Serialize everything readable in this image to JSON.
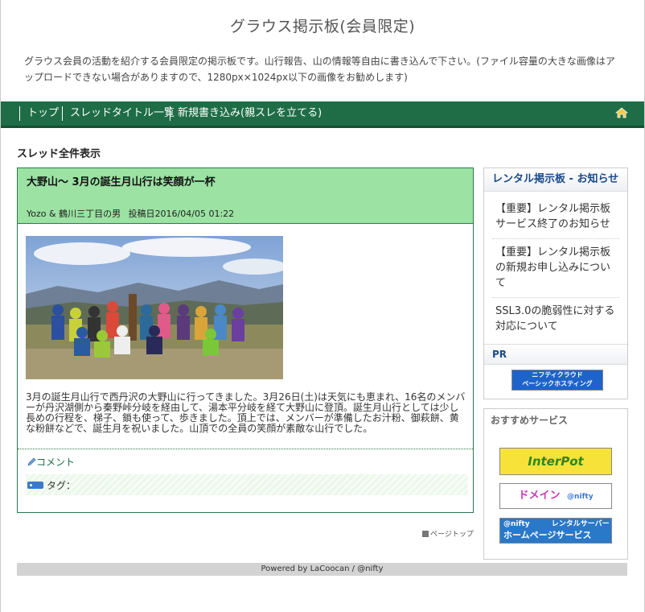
{
  "site": {
    "title": "グラウス掲示板(会員限定)",
    "description": "グラウス会員の活動を紹介する会員限定の掲示板です。山行報告、山の情報等自由に書き込んで下さい。(ファイル容量の大きな画像はアップロードできない場合がありますので、1280px×1024px以下の画像をお勧めします)"
  },
  "nav": {
    "items": [
      "トップ",
      "スレッドタイトル一覧",
      "新規書き込み(親スレを立てる)"
    ],
    "home_icon": "home-icon"
  },
  "section_title": "スレッド全件表示",
  "thread": {
    "title": "大野山～ 3月の誕生月山行は笑顔が一杯",
    "author": "Yozo & 鶴川三丁目の男",
    "posted_label": "投稿日",
    "posted_at": "2016/04/05 01:22",
    "body": "3月の誕生月山行で西丹沢の大野山に行ってきました。3月26日(土)は天気にも恵まれ、16名のメンバーが丹沢湖側から秦野峠分岐を経由して、湯本平分岐を経て大野山に登頂。誕生月山行としては少し長めの行程を、梯子、鎖も使って、歩きました。頂上では、メンバーが準備したお汁粉、御萩餅、黄な粉餅などで、誕生月を祝いました。山頂での全員の笑顔が素敵な山行でした。",
    "comment_label": "コメント",
    "tag_label": "タグ："
  },
  "pagetop_label": "ページトップ",
  "sidebar": {
    "news_title": "レンタル掲示板 - お知らせ",
    "news": [
      "【重要】レンタル掲示板サービス終了のお知らせ",
      "【重要】レンタル掲示板の新規お申し込みについて",
      "SSL3.0の脆弱性に対する対応について"
    ],
    "pr_title": "PR",
    "pr_banner": {
      "line1": "ニフティクラウド",
      "line2": "ベーシックホスティング"
    },
    "recommend_title": "おすすめサービス",
    "banners": {
      "interpot": "InterPot",
      "domain": "ドメイン",
      "domain_brand": "@nifty",
      "hp_brand": "@nifty",
      "hp_sub": "レンタルサーバー",
      "hp_main": "ホームページサービス"
    }
  },
  "footer": "Powered by LaCoocan / @nifty",
  "colors": {
    "nav": "#1e6d46",
    "thread_head": "#9be2a3",
    "side_title": "#1a4a8a"
  }
}
